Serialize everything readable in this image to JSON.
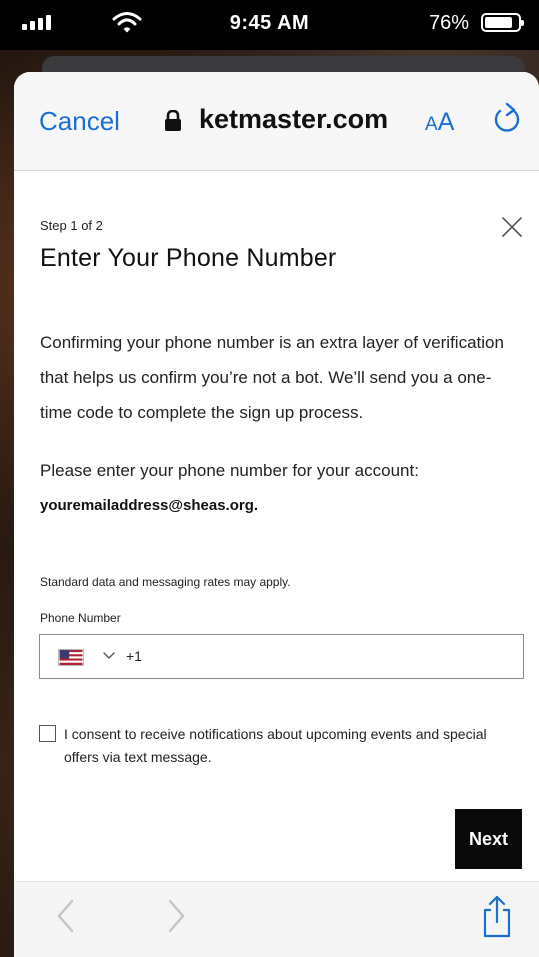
{
  "status_bar": {
    "time": "9:45 AM",
    "battery_percent": "76%",
    "battery_level": 76,
    "signal_icon": "cellular-signal-icon",
    "wifi_icon": "wifi-icon",
    "battery_icon": "battery-icon"
  },
  "browser": {
    "cancel_label": "Cancel",
    "url": "ketmaster.com",
    "text_size_label_small": "A",
    "text_size_label_large": "A",
    "lock_icon": "lock-icon",
    "reload_icon": "reload-icon"
  },
  "form": {
    "step": "Step 1 of 2",
    "title": "Enter Your Phone Number",
    "intro": "Confirming your phone number is an extra layer of verification that helps us confirm you’re not a bot. We’ll send you a one-time code to complete the sign up process.",
    "prompt": "Please enter your phone number for your account:",
    "email": "youremailaddress@sheas.org.",
    "rates_notice": "Standard data and messaging rates may apply.",
    "phone_label": "Phone Number",
    "country_code": "+1",
    "phone_value": "",
    "consent_text": "I consent to receive notifications about upcoming events and special offers via text message.",
    "consent_checked": false,
    "next_label": "Next"
  },
  "toolbar": {
    "back_icon": "chevron-left-icon",
    "forward_icon": "chevron-right-icon",
    "share_icon": "share-icon"
  },
  "colors": {
    "accent": "#1a6fd1",
    "button_bg": "#0a0a0a",
    "flag_red": "#b22234",
    "flag_blue": "#3c3b6e"
  }
}
